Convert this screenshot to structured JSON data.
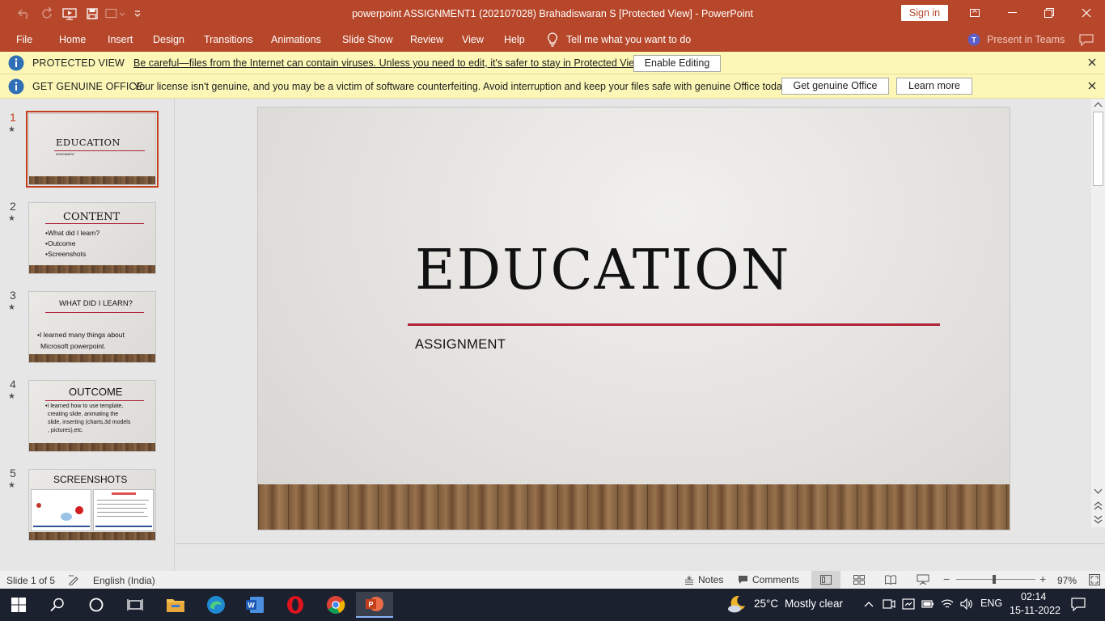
{
  "window": {
    "title": "powerpoint ASSIGNMENT1 (202107028) Brahadiswaran S [Protected View]  -  PowerPoint",
    "sign_in": "Sign in"
  },
  "ribbon": {
    "tabs": [
      "File",
      "Home",
      "Insert",
      "Design",
      "Transitions",
      "Animations",
      "Slide Show",
      "Review",
      "View",
      "Help"
    ],
    "tell_me": "Tell me what you want to do",
    "present_in_teams": "Present in Teams"
  },
  "protected_view": {
    "title": "PROTECTED VIEW",
    "message": "Be careful—files from the Internet can contain viruses. Unless you need to edit, it's safer to stay in Protected View.",
    "enable_button": "Enable Editing"
  },
  "genuine_office": {
    "title": "GET GENUINE OFFICE",
    "message": "Your license isn't genuine, and you may be a victim of software counterfeiting. Avoid interruption and keep your files safe with genuine Office today.",
    "get_button": "Get genuine Office",
    "learn_button": "Learn more"
  },
  "thumbnails": [
    {
      "number": "1",
      "title": "EDUCATION",
      "subtitle": "ASSIGNMENT",
      "bullets": []
    },
    {
      "number": "2",
      "title": "CONTENT",
      "bullets": [
        "•What did I learn?",
        "•Outcome",
        "•Screenshots"
      ]
    },
    {
      "number": "3",
      "title": "WHAT DID I LEARN?",
      "bullets": [
        "•I learned many things about",
        "Microsoft powerpoint."
      ]
    },
    {
      "number": "4",
      "title": "OUTCOME",
      "bullets": [
        "•I learned how to use template,",
        "creating slide, animating the",
        "slide, inserting (charts,3d models",
        ", pictures),etc."
      ]
    },
    {
      "number": "5",
      "title": "SCREENSHOTS",
      "bullets": []
    }
  ],
  "slide": {
    "title": "EDUCATION",
    "subtitle": "ASSIGNMENT"
  },
  "status": {
    "slide_counter": "Slide 1 of 5",
    "language": "English (India)",
    "notes": "Notes",
    "comments": "Comments",
    "zoom": "97%"
  },
  "taskbar": {
    "weather_temp": "25°C",
    "weather_text": "Mostly clear",
    "language": "ENG",
    "time": "02:14",
    "date": "15-11-2022"
  },
  "colors": {
    "accent": "#b7472a",
    "message_bar": "#fcf7b6",
    "slide_rule": "#b0223a",
    "taskbar": "#1c2130"
  }
}
